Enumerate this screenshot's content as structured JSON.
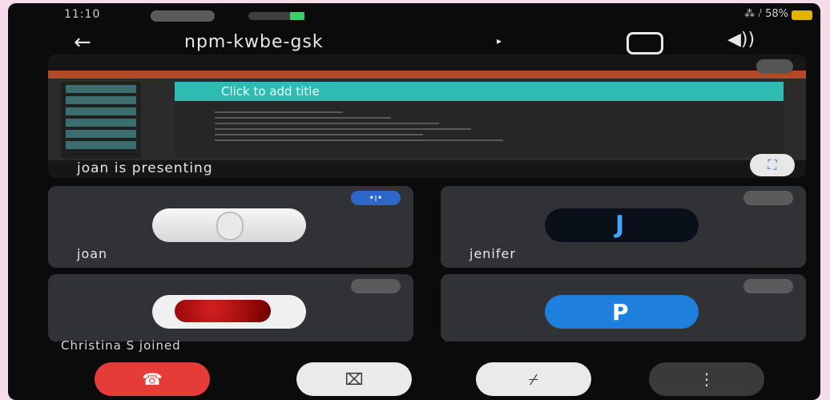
{
  "status_bar": {
    "time": "11:10",
    "right_text": "⁂ ᵢᴵ 58%"
  },
  "top_bar": {
    "back_icon": "←",
    "meeting_code": "npm-kwbe-gsk",
    "code_arrow": "▸",
    "speaker_icon": "◀))"
  },
  "presentation": {
    "slide_title": "Click to add title",
    "presenter_label": "joan is presenting",
    "fullscreen_icon": "⛶"
  },
  "participants": [
    {
      "name": "joan",
      "indicator": "•ı•",
      "avatar_kind": "photo"
    },
    {
      "name": "jenifer",
      "avatar_kind": "logo",
      "avatar_letter": "J"
    },
    {
      "name": "",
      "avatar_kind": "rose"
    },
    {
      "name": "",
      "avatar_kind": "letter",
      "avatar_letter": "P"
    }
  ],
  "notice": {
    "joined_text": "Christina S joined"
  },
  "controls": {
    "end_icon": "☎",
    "video_icon": "⌧",
    "mic_icon": "⌿",
    "more_icon": "⋮"
  }
}
